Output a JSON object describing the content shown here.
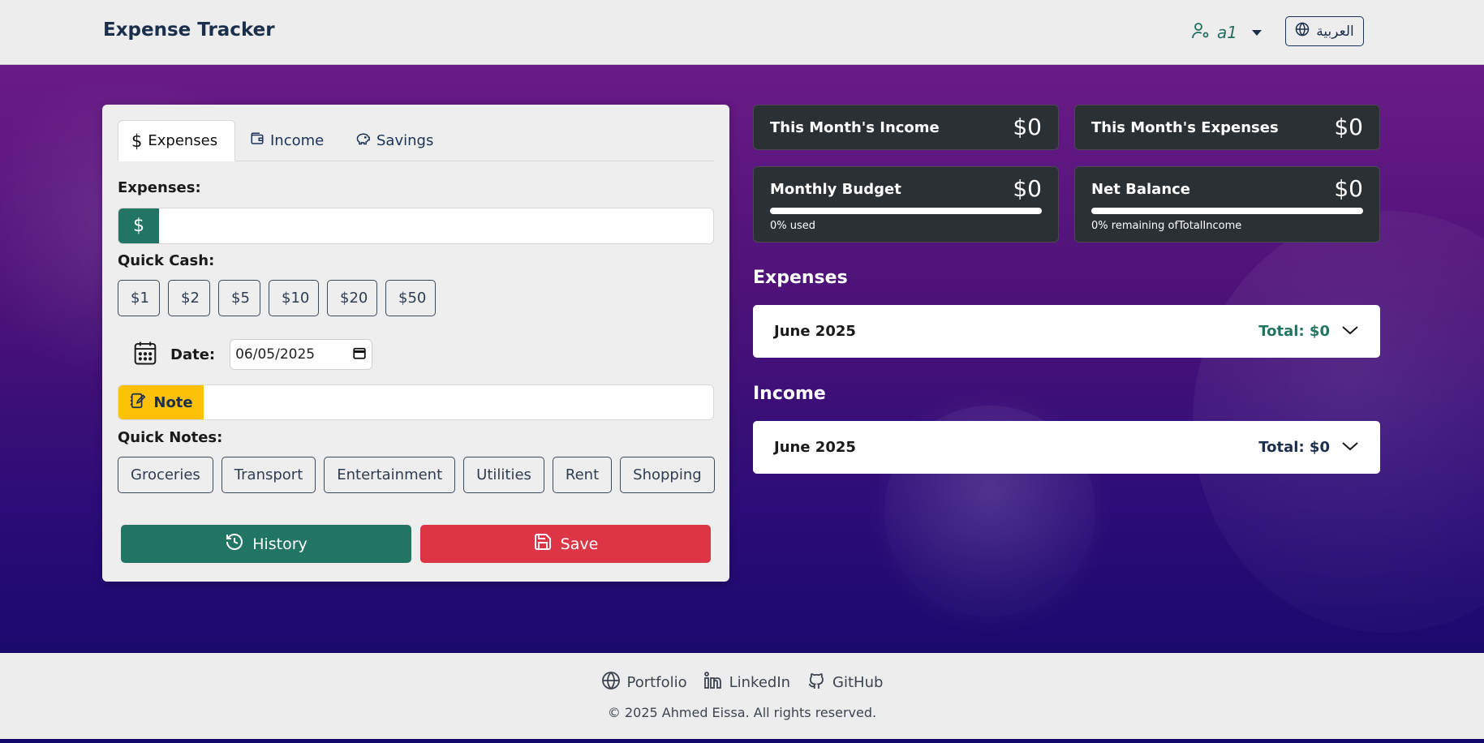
{
  "header": {
    "brand": "Expense Tracker",
    "user_name": "a1",
    "language_button": "العربية"
  },
  "form": {
    "tabs": [
      {
        "label": "Expenses",
        "icon": "dollar-icon",
        "active": true
      },
      {
        "label": "Income",
        "icon": "wallet-icon",
        "active": false
      },
      {
        "label": "Savings",
        "icon": "piggy-bank-icon",
        "active": false
      }
    ],
    "amount_label": "Expenses:",
    "currency_symbol": "$",
    "amount_value": "",
    "quick_cash_label": "Quick Cash:",
    "quick_cash": [
      "$1",
      "$2",
      "$5",
      "$10",
      "$20",
      "$50"
    ],
    "date_label": "Date:",
    "date_value": "06/05/2025",
    "note_label": "Note",
    "note_value": "",
    "quick_notes_label": "Quick Notes:",
    "quick_notes": [
      "Groceries",
      "Transport",
      "Entertainment",
      "Utilities",
      "Rent",
      "Shopping"
    ],
    "history_button": "History",
    "save_button": "Save"
  },
  "stats": {
    "income": {
      "title": "This Month's Income",
      "value": "$0"
    },
    "expenses": {
      "title": "This Month's Expenses",
      "value": "$0"
    },
    "budget": {
      "title": "Monthly Budget",
      "value": "$0",
      "note": "0% used",
      "progress": 0
    },
    "balance": {
      "title": "Net Balance",
      "value": "$0",
      "note": "0% remaining ofTotalIncome",
      "progress": 0
    }
  },
  "expenses_section": {
    "title": "Expenses",
    "month": "June 2025",
    "total": "Total: $0",
    "total_color": "#237563"
  },
  "income_section": {
    "title": "Income",
    "month": "June 2025",
    "total": "Total: $0",
    "total_color": "#1b2f4d"
  },
  "footer": {
    "links": [
      {
        "label": "Portfolio",
        "icon": "globe-icon"
      },
      {
        "label": "LinkedIn",
        "icon": "linkedin-icon"
      },
      {
        "label": "GitHub",
        "icon": "github-icon"
      }
    ],
    "copyright": "© 2025 Ahmed Eissa. All rights reserved."
  },
  "colors": {
    "primary": "#237563",
    "danger": "#dc3545",
    "warning": "#fec107",
    "card_dark": "#2b3035"
  }
}
